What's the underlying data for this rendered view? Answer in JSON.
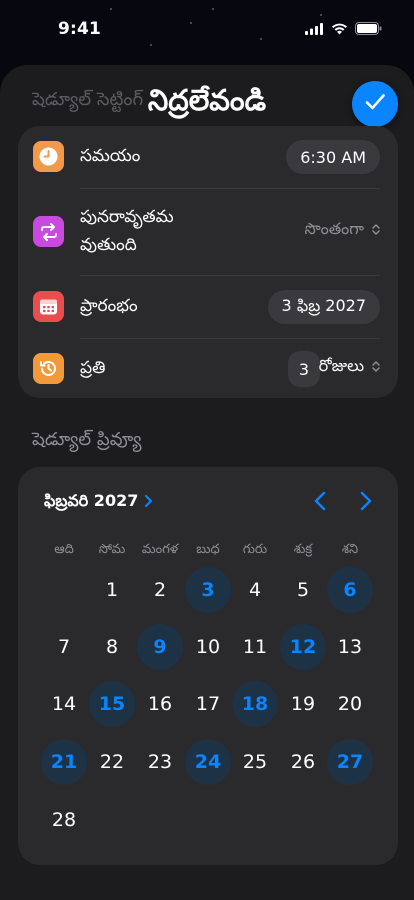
{
  "status_bar": {
    "time": "9:41"
  },
  "sheet": {
    "ghost_title": "షెడ్యూల్ సెట్టింగ్",
    "title": "నిద్రలేవండి",
    "done_label": "Done"
  },
  "settings": {
    "rows": [
      {
        "label": "సమయం",
        "value": "6:30 AM"
      },
      {
        "label_line1": "పునరావృతమ",
        "label_line2": "వుతుంది",
        "value": "సొంతంగా"
      },
      {
        "label": "ప్రారంభం",
        "value": "3 ఫిబ్ర 2027"
      },
      {
        "label": "ప్రతి",
        "count": "3",
        "unit": "రోజులు"
      }
    ]
  },
  "preview": {
    "section_label": "షెడ్యూల్ ప్రివ్యూ",
    "month_label": "ఫిబ్రవరి 2027",
    "weekdays": [
      "ఆది",
      "సోమ",
      "మంగళ",
      "బుధ",
      "గురు",
      "శుక్ర",
      "శని"
    ],
    "days": [
      "1",
      "2",
      "3",
      "4",
      "5",
      "6",
      "7",
      "8",
      "9",
      "10",
      "11",
      "12",
      "13",
      "14",
      "15",
      "16",
      "17",
      "18",
      "19",
      "20",
      "21",
      "22",
      "23",
      "24",
      "25",
      "26",
      "27",
      "28"
    ],
    "highlighted_days": [
      3,
      6,
      9,
      12,
      15,
      18,
      21,
      24,
      27
    ],
    "first_weekday_index": 1
  },
  "colors": {
    "accent": "#0a84ff",
    "clock_icon": "#f2994a",
    "repeat_icon": "#c94ae0",
    "calendar_icon": "#ea4d4d",
    "history_icon": "#f29a3a"
  }
}
